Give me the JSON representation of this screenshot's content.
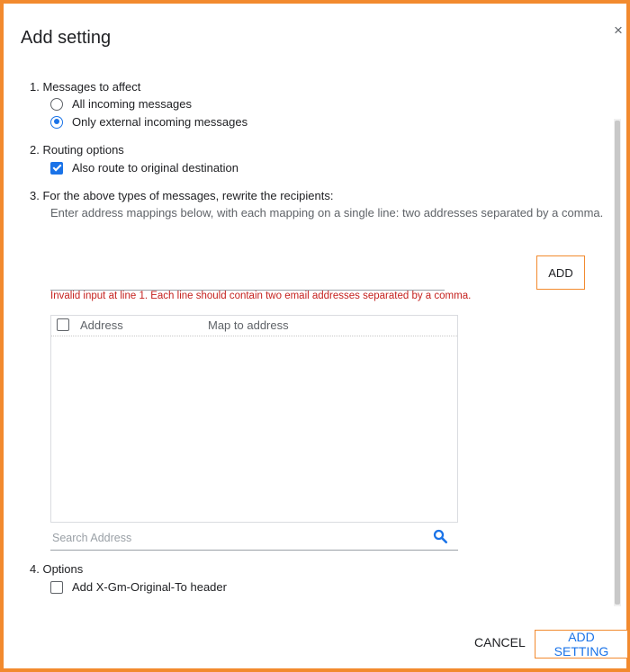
{
  "dialog": {
    "title": "Add setting",
    "close_label": "×"
  },
  "section1": {
    "label": "1. Messages to affect",
    "options": [
      {
        "label": "All incoming messages",
        "checked": false
      },
      {
        "label": "Only external incoming messages",
        "checked": true
      }
    ]
  },
  "section2": {
    "label": "2. Routing options",
    "checkbox_label": "Also route to original destination",
    "checked": true
  },
  "section3": {
    "label": "3. For the above types of messages, rewrite the recipients:",
    "help": "Enter address mappings below, with each mapping on a single line: two addresses separated by a comma.",
    "input_value": "",
    "add_label": "ADD",
    "error": "Invalid input at line 1. Each line should contain two email addresses separated by a comma.",
    "table": {
      "columns": [
        "Address",
        "Map to address"
      ],
      "rows": []
    },
    "search_placeholder": "Search Address"
  },
  "section4": {
    "label": "4. Options",
    "checkbox_label": "Add X-Gm-Original-To header",
    "checked": false
  },
  "footer": {
    "cancel_label": "CANCEL",
    "submit_label": "ADD SETTING"
  },
  "colors": {
    "accent": "#1a73e8",
    "highlight": "#f28a2e",
    "error": "#c5221f"
  }
}
